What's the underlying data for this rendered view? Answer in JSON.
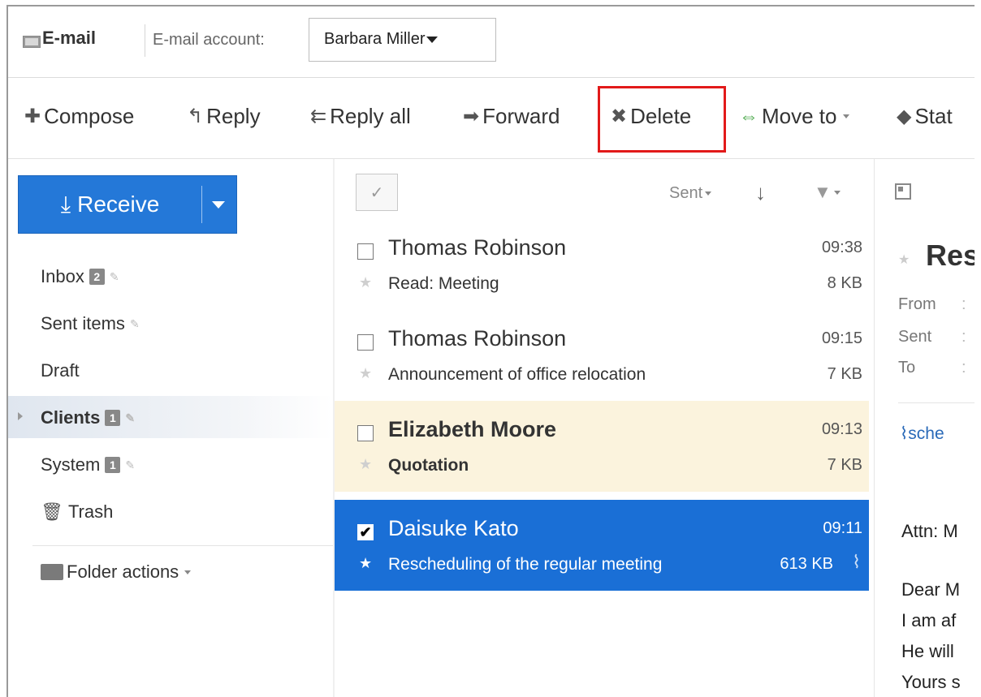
{
  "header": {
    "app_title": "E-mail",
    "account_label": "E-mail account:",
    "account_selected": "Barbara Miller"
  },
  "toolbar": {
    "compose": "Compose",
    "reply": "Reply",
    "reply_all": "Reply all",
    "forward": "Forward",
    "delete": "Delete",
    "move_to": "Move to",
    "status": "Stat"
  },
  "sidebar": {
    "receive": "Receive",
    "folders": [
      {
        "label": "Inbox",
        "badge": "2"
      },
      {
        "label": "Sent items",
        "badge": ""
      },
      {
        "label": "Draft",
        "badge": ""
      },
      {
        "label": "Clients",
        "badge": "1"
      },
      {
        "label": "System",
        "badge": "1"
      },
      {
        "label": "Trash",
        "badge": ""
      }
    ],
    "folder_actions": "Folder actions"
  },
  "list": {
    "sort_label": "Sent",
    "messages": [
      {
        "sender": "Thomas Robinson",
        "time": "09:38",
        "subject": "Read: Meeting",
        "size": "8 KB",
        "state": "normal"
      },
      {
        "sender": "Thomas Robinson",
        "time": "09:15",
        "subject": "Announcement of office relocation",
        "size": "7 KB",
        "state": "normal"
      },
      {
        "sender": "Elizabeth Moore",
        "time": "09:13",
        "subject": "Quotation",
        "size": "7 KB",
        "state": "unread"
      },
      {
        "sender": "Daisuke Kato",
        "time": "09:11",
        "subject": "Rescheduling of the regular meeting",
        "size": "613 KB",
        "state": "selected"
      }
    ]
  },
  "preview": {
    "title": "Res",
    "from_label": "From",
    "sent_label": "Sent",
    "to_label": "To",
    "attachment": "sche",
    "body_lines": [
      "Attn: M",
      "Dear M",
      "I am af",
      "He will",
      "Yours s"
    ]
  },
  "colors": {
    "accent": "#2478d8",
    "selected_row": "#1a6fd6",
    "unread_row": "#fbf3dd",
    "highlight_box": "#e21a1a"
  }
}
